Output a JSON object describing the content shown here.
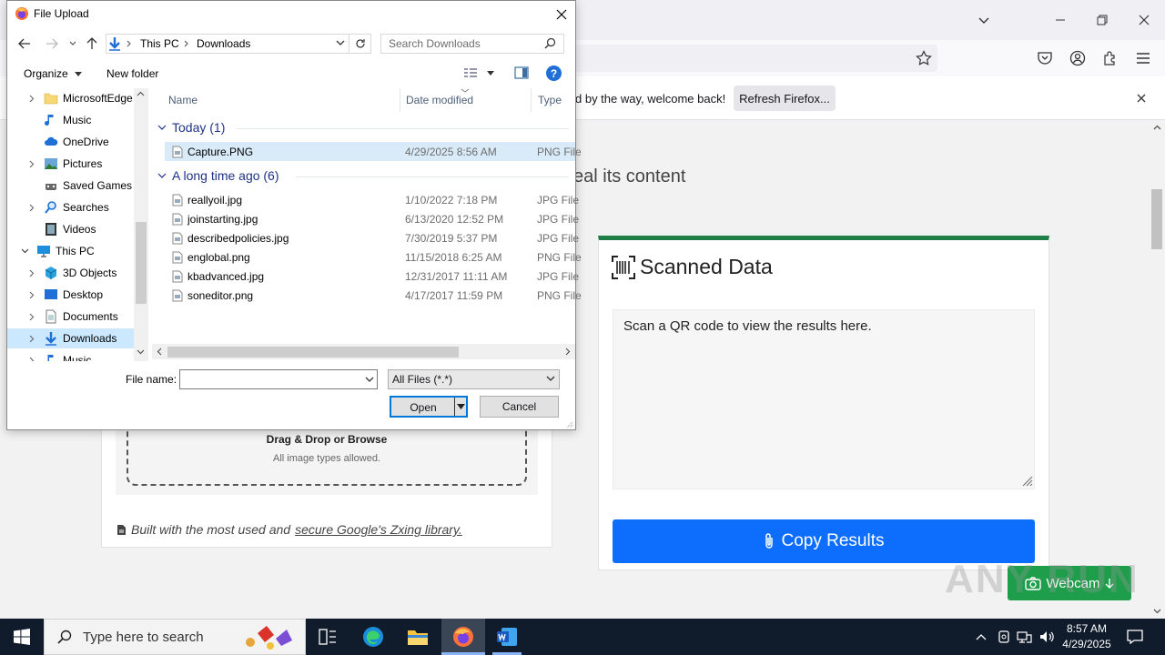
{
  "browser": {
    "notification_text": "d by the way, welcome back!",
    "refresh_label": "Refresh Firefox..."
  },
  "page": {
    "heading_fragment": "eal its content",
    "drop_title": "Drag & Drop or Browse",
    "drop_subtitle": "All image types allowed.",
    "built_with_prefix": "Built with the most used and",
    "built_with_link": "secure Google's Zxing library.",
    "scanned_title": "Scanned Data",
    "result_placeholder": "Scan a QR code to view the results here.",
    "copy_label": "Copy Results",
    "webcam_label": "Webcam",
    "watermark": "ANY RUN",
    "accent_color": "#1e7e45",
    "button_color": "#0d6efd"
  },
  "dialog": {
    "title": "File Upload",
    "breadcrumb": [
      "This PC",
      "Downloads"
    ],
    "search_placeholder": "Search Downloads",
    "organize_label": "Organize",
    "new_folder_label": "New folder",
    "help_label": "?",
    "nav_items": [
      {
        "label": "MicrosoftEdge",
        "icon": "folder-icon"
      },
      {
        "label": "Music",
        "icon": "music-icon"
      },
      {
        "label": "OneDrive",
        "icon": "cloud-icon"
      },
      {
        "label": "Pictures",
        "icon": "pictures-icon"
      },
      {
        "label": "Saved Games",
        "icon": "saved-games-icon"
      },
      {
        "label": "Searches",
        "icon": "search-folder-icon"
      },
      {
        "label": "Videos",
        "icon": "videos-icon"
      },
      {
        "label": "This PC",
        "icon": "computer-icon"
      },
      {
        "label": "3D Objects",
        "icon": "3d-objects-icon"
      },
      {
        "label": "Desktop",
        "icon": "desktop-icon"
      },
      {
        "label": "Documents",
        "icon": "documents-icon"
      },
      {
        "label": "Downloads",
        "icon": "downloads-icon"
      },
      {
        "label": "Music",
        "icon": "music-icon"
      }
    ],
    "columns": {
      "name": "Name",
      "date": "Date modified",
      "type": "Type"
    },
    "groups": [
      {
        "label": "Today (1)",
        "files": [
          {
            "name": "Capture.PNG",
            "date": "4/29/2025 8:56 AM",
            "type": "PNG File"
          }
        ]
      },
      {
        "label": "A long time ago (6)",
        "files": [
          {
            "name": "reallyoil.jpg",
            "date": "1/10/2022 7:18 PM",
            "type": "JPG File"
          },
          {
            "name": "joinstarting.jpg",
            "date": "6/13/2020 12:52 PM",
            "type": "JPG File"
          },
          {
            "name": "describedpolicies.jpg",
            "date": "7/30/2019 5:37 PM",
            "type": "JPG File"
          },
          {
            "name": "englobal.png",
            "date": "11/15/2018 6:25 AM",
            "type": "PNG File"
          },
          {
            "name": "kbadvanced.jpg",
            "date": "12/31/2017 11:11 AM",
            "type": "JPG File"
          },
          {
            "name": "soneditor.png",
            "date": "4/17/2017 11:59 PM",
            "type": "PNG File"
          }
        ]
      }
    ],
    "file_name_label": "File name:",
    "file_name_value": "",
    "file_type_value": "All Files (*.*)",
    "open_label": "Open",
    "cancel_label": "Cancel"
  },
  "taskbar": {
    "search_placeholder": "Type here to search",
    "time": "8:57 AM",
    "date": "4/29/2025"
  }
}
